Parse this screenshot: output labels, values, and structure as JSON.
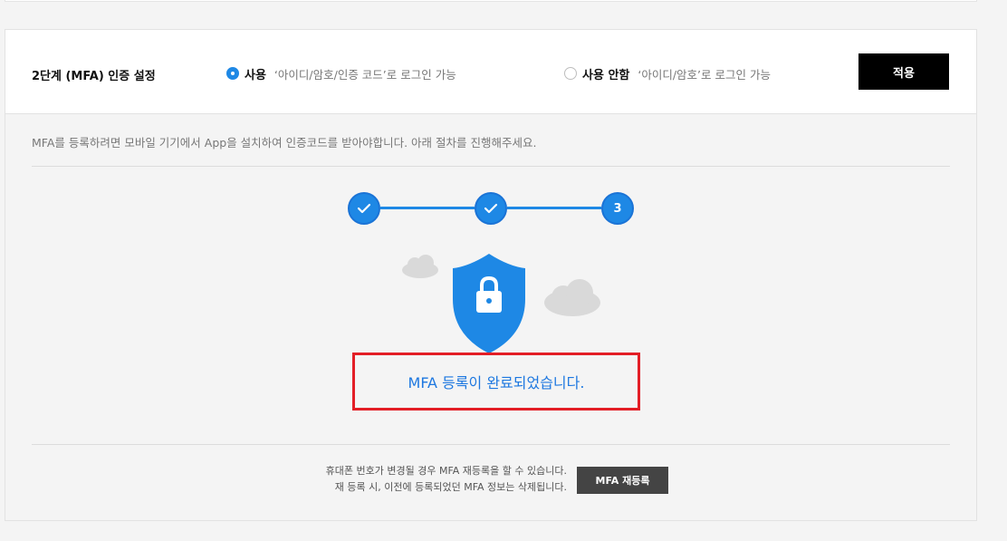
{
  "mfa_setting": {
    "title": "2단계 (MFA) 인증 설정",
    "option_use": {
      "label": "사용",
      "description": "‘아이디/암호/인증 코드’로 로그인 가능",
      "selected": true
    },
    "option_no_use": {
      "label": "사용 안함",
      "description": "‘아이디/암호’로 로그인 가능",
      "selected": false
    },
    "apply_label": "적용"
  },
  "info_text": "MFA를 등록하려면 모바일 기기에서 App을 설치하여 인증코드를 받아야합니다. 아래 절차를 진행해주세요.",
  "stepper": {
    "steps": [
      {
        "state": "done",
        "icon": "check-icon"
      },
      {
        "state": "done",
        "icon": "check-icon"
      },
      {
        "state": "current",
        "label": "3"
      }
    ]
  },
  "illustration": {
    "icons": [
      "shield-lock-icon",
      "cloud-icon"
    ]
  },
  "completion_message": "MFA 등록이 완료되었습니다.",
  "re_register": {
    "note_line1": "휴대폰 번호가 변경될 경우 MFA 재등록을 할 수 있습니다.",
    "note_line2": "재 등록 시, 이전에 등록되었던 MFA 정보는 삭제됩니다.",
    "button_label": "MFA 재등록"
  },
  "colors": {
    "accent": "#1e88e5",
    "highlight_border": "#e31e26",
    "apply_button": "#000000",
    "re_register_button": "#444444"
  }
}
